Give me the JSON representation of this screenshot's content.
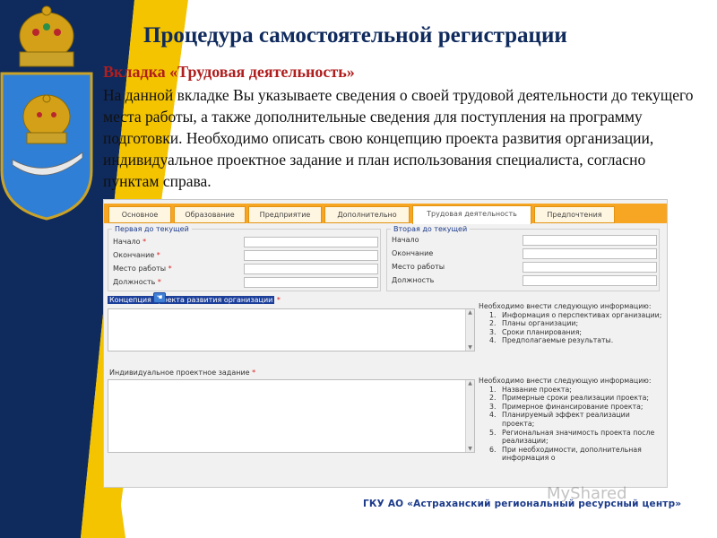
{
  "slide": {
    "title": "Процедура самостоятельной регистрации",
    "subhead": "Вкладка «Трудовая деятельность»",
    "intro": "На данной вкладке Вы указываете сведения о своей трудовой деятельности до текущего места работы, а также дополнительные сведения для поступления на программу подготовки. Необходимо описать свою концепцию проекта развития организации, индивидуальное проектное задание и план использования специалиста, согласно пунктам справа.",
    "footer": "ГКУ АО «Астраханский региональный ресурсный центр»",
    "watermark": "MyShared"
  },
  "colors": {
    "navy": "#0f2a5c",
    "accent_red": "#b01e1e",
    "tab_orange": "#f6a623",
    "band_yellow": "#f4c400"
  },
  "form": {
    "tabs": [
      "Основное",
      "Образование",
      "Предприятие",
      "Дополнительно",
      "Трудовая деятельность",
      "Предпочтения"
    ],
    "active_tab": "Трудовая деятельность",
    "group1": {
      "legend": "Первая до текущей",
      "fields": [
        "Начало",
        "Окончание",
        "Место работы",
        "Должность"
      ],
      "required_mark": "*"
    },
    "group2": {
      "legend": "Вторая до текущей",
      "fields": [
        "Начало",
        "Окончание",
        "Место работы",
        "Должность"
      ]
    },
    "concept": {
      "label": "Концепция проекта развития организации",
      "required_mark": "*",
      "note_head": "Необходимо внести следующую информацию:",
      "items": [
        {
          "n": "1.",
          "text": "Информация о перспективах организации;"
        },
        {
          "n": "2.",
          "text": "Планы организации;"
        },
        {
          "n": "3.",
          "text": "Сроки планирования;"
        },
        {
          "n": "4.",
          "text": "Предполагаемые результаты."
        }
      ]
    },
    "task": {
      "label": "Индивидуальное проектное задание",
      "required_mark": "*",
      "note_head": "Необходимо внести следующую информацию:",
      "items": [
        {
          "n": "1.",
          "text": "Название проекта;"
        },
        {
          "n": "2.",
          "text": "Примерные сроки реализации проекта;"
        },
        {
          "n": "3.",
          "text": "Примерное финансирование проекта;"
        },
        {
          "n": "4.",
          "text": "Планируемый эффект реализации проекта;"
        },
        {
          "n": "5.",
          "text": "Региональная значимость проекта после реализации;"
        },
        {
          "n": "6.",
          "text": "При необходимости, дополнительная информация о"
        }
      ]
    }
  }
}
